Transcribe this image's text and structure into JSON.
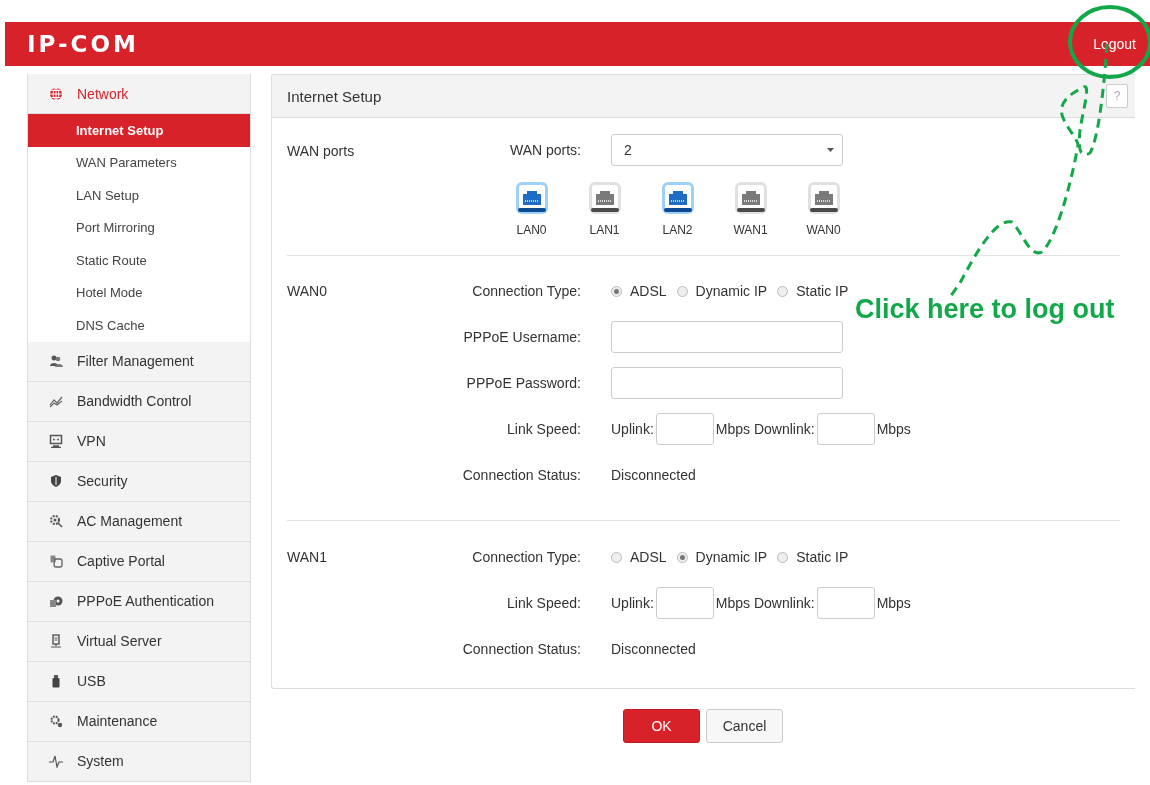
{
  "header": {
    "logo": "IP-COM",
    "logout": "Logout"
  },
  "sidebar": {
    "items": [
      {
        "label": "Network",
        "selected": true,
        "children": [
          {
            "label": "Internet Setup",
            "selected": true
          },
          {
            "label": "WAN Parameters",
            "selected": false
          },
          {
            "label": "LAN Setup",
            "selected": false
          },
          {
            "label": "Port Mirroring",
            "selected": false
          },
          {
            "label": "Static Route",
            "selected": false
          },
          {
            "label": "Hotel Mode",
            "selected": false
          },
          {
            "label": "DNS Cache",
            "selected": false
          }
        ]
      },
      {
        "label": "Filter Management",
        "selected": false
      },
      {
        "label": "Bandwidth Control",
        "selected": false
      },
      {
        "label": "VPN",
        "selected": false
      },
      {
        "label": "Security",
        "selected": false
      },
      {
        "label": "AC Management",
        "selected": false
      },
      {
        "label": "Captive Portal",
        "selected": false
      },
      {
        "label": "PPPoE Authentication",
        "selected": false
      },
      {
        "label": "Virtual Server",
        "selected": false
      },
      {
        "label": "USB",
        "selected": false
      },
      {
        "label": "Maintenance",
        "selected": false
      },
      {
        "label": "System",
        "selected": false
      }
    ]
  },
  "panel": {
    "title": "Internet Setup",
    "help": "?",
    "sections": [
      {
        "kind": "ports",
        "title": "WAN ports",
        "field_label": "WAN ports:",
        "value": "2",
        "ports": [
          {
            "label": "LAN0",
            "active": true
          },
          {
            "label": "LAN1",
            "active": false
          },
          {
            "label": "LAN2",
            "active": true
          },
          {
            "label": "WAN1",
            "active": false
          },
          {
            "label": "WAN0",
            "active": false
          }
        ]
      },
      {
        "kind": "wan",
        "title": "WAN0",
        "rows": [
          {
            "kind": "radio",
            "label": "Connection Type:",
            "options": [
              {
                "label": "ADSL",
                "selected": true
              },
              {
                "label": "Dynamic IP",
                "selected": false
              },
              {
                "label": "Static IP",
                "selected": false
              }
            ]
          },
          {
            "kind": "text",
            "label": "PPPoE Username:"
          },
          {
            "kind": "text",
            "label": "PPPoE Password:"
          },
          {
            "kind": "speed",
            "label": "Link Speed:",
            "uplink": "Uplink:",
            "middle": "Mbps Downlink:",
            "unit": "Mbps"
          },
          {
            "kind": "status",
            "label": "Connection Status:",
            "value": "Disconnected"
          }
        ]
      },
      {
        "kind": "wan",
        "title": "WAN1",
        "rows": [
          {
            "kind": "radio",
            "label": "Connection Type:",
            "options": [
              {
                "label": "ADSL",
                "selected": false
              },
              {
                "label": "Dynamic IP",
                "selected": true
              },
              {
                "label": "Static IP",
                "selected": false
              }
            ]
          },
          {
            "kind": "speed",
            "label": "Link Speed:",
            "uplink": "Uplink:",
            "middle": "Mbps Downlink:",
            "unit": "Mbps"
          },
          {
            "kind": "status",
            "label": "Connection Status:",
            "value": "Disconnected"
          }
        ]
      }
    ]
  },
  "buttons": [
    {
      "label": "OK",
      "primary": true
    },
    {
      "label": "Cancel",
      "primary": false
    }
  ],
  "annotation": {
    "text": "Click here to log out"
  }
}
